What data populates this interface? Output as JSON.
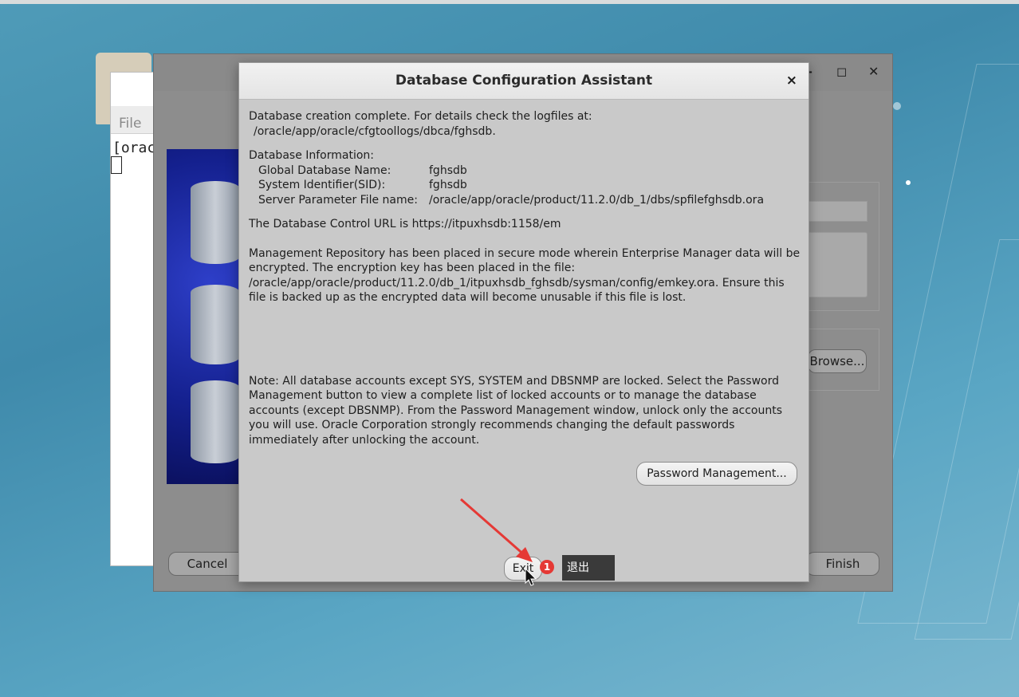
{
  "terminal": {
    "menu_file": "File",
    "prompt": "[orac"
  },
  "wizard": {
    "cancel_label": "Cancel",
    "finish_label": "Finish",
    "browse_label": "Browse..."
  },
  "dialog": {
    "title": "Database Configuration Assistant",
    "close_glyph": "×",
    "creation_line1": "Database creation complete. For details check the logfiles at:",
    "creation_line2": "/oracle/app/oracle/cfgtoollogs/dbca/fghsdb.",
    "info_heading": "Database Information:",
    "info": [
      {
        "key": "Global Database Name:",
        "value": "fghsdb"
      },
      {
        "key": "System Identifier(SID):",
        "value": "fghsdb"
      },
      {
        "key": "Server Parameter File name:",
        "value": "/oracle/app/oracle/product/11.2.0/db_1/dbs/spfilefghsdb.ora"
      }
    ],
    "control_url": "The Database Control URL is https://itpuxhsdb:1158/em",
    "repository_text": "Management Repository has been placed in secure mode wherein Enterprise Manager data will be encrypted.  The encryption key has been placed in the file: /oracle/app/oracle/product/11.2.0/db_1/itpuxhsdb_fghsdb/sysman/config/emkey.ora. Ensure this file is backed up as the encrypted data will become unusable if this file is lost.",
    "note_text": "Note: All database accounts except SYS, SYSTEM and DBSNMP are locked. Select the Password Management button to view a complete list of locked accounts or to manage the database accounts (except DBSNMP). From the Password Management window, unlock only the accounts you will use. Oracle Corporation strongly recommends changing the default passwords immediately after unlocking the account.",
    "password_mgmt_label": "Password Management...",
    "exit_label": "Exit"
  },
  "annotation": {
    "badge_number": "1",
    "tooltip_text": "退出",
    "arrow_color": "#e53935"
  }
}
